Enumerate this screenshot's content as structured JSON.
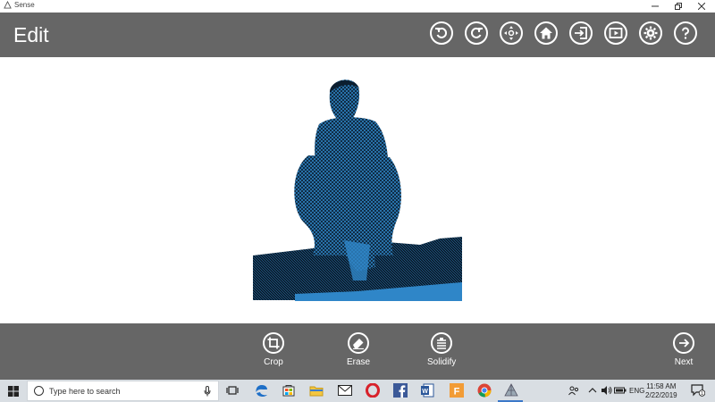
{
  "window": {
    "app_name": "Sense"
  },
  "header": {
    "title": "Edit"
  },
  "toolbar": {
    "icons": [
      "undo-icon",
      "redo-icon",
      "move-icon",
      "home-icon",
      "exit-icon",
      "play-icon",
      "settings-icon",
      "help-icon"
    ]
  },
  "footer": {
    "crop_label": "Crop",
    "erase_label": "Erase",
    "solidify_label": "Solidify",
    "next_label": "Next"
  },
  "taskbar": {
    "search_placeholder": "Type here to search",
    "language": "ENG",
    "time": "11:58 AM",
    "date": "2/22/2019",
    "notification_count": "1"
  },
  "colors": {
    "header_bg": "#666666",
    "mesh_blue": "#2f86c8",
    "mesh_dark": "#0b1e30",
    "taskbar_bg": "#d9dee3"
  }
}
